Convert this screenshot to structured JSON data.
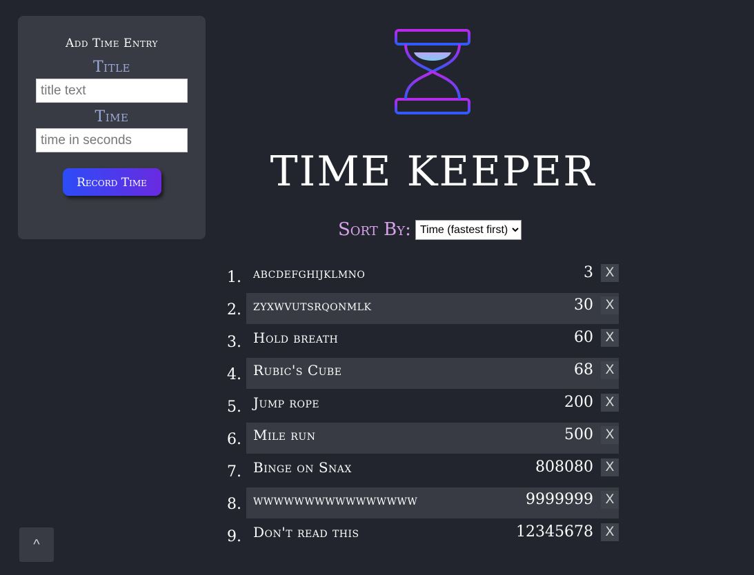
{
  "form": {
    "heading": "Add Time Entry",
    "title_label": "Title",
    "title_placeholder": "title text",
    "time_label": "Time",
    "time_placeholder": "time in seconds",
    "submit_label": "Record Time"
  },
  "app": {
    "title": "TIME KEEPER",
    "logo_icon": "hourglass-icon",
    "colors": {
      "accent_blue": "#2c4cf8",
      "accent_purple": "#9b2ee6",
      "sort_label": "#d9a3ec",
      "field_label": "#9eaad9"
    }
  },
  "sort": {
    "label": "Sort By:",
    "selected": "Time (fastest first)"
  },
  "entries": [
    {
      "num": "1.",
      "title": "abcdefghijklmno",
      "time": "3",
      "delete": "X"
    },
    {
      "num": "2.",
      "title": "zyxwvutsrqonmlk",
      "time": "30",
      "delete": "X"
    },
    {
      "num": "3.",
      "title": "Hold breath",
      "time": "60",
      "delete": "X"
    },
    {
      "num": "4.",
      "title": "Rubic's Cube",
      "time": "68",
      "delete": "X"
    },
    {
      "num": "5.",
      "title": "Jump rope",
      "time": "200",
      "delete": "X"
    },
    {
      "num": "6.",
      "title": "Mile run",
      "time": "500",
      "delete": "X"
    },
    {
      "num": "7.",
      "title": "Binge on Snax",
      "time": "808080",
      "delete": "X"
    },
    {
      "num": "8.",
      "title": "wwwwwwwwwwwwwwww",
      "time": "9999999",
      "delete": "X"
    },
    {
      "num": "9.",
      "title": "Don't read this",
      "time": "12345678",
      "delete": "X"
    }
  ],
  "scroll_top": {
    "label": "^"
  }
}
